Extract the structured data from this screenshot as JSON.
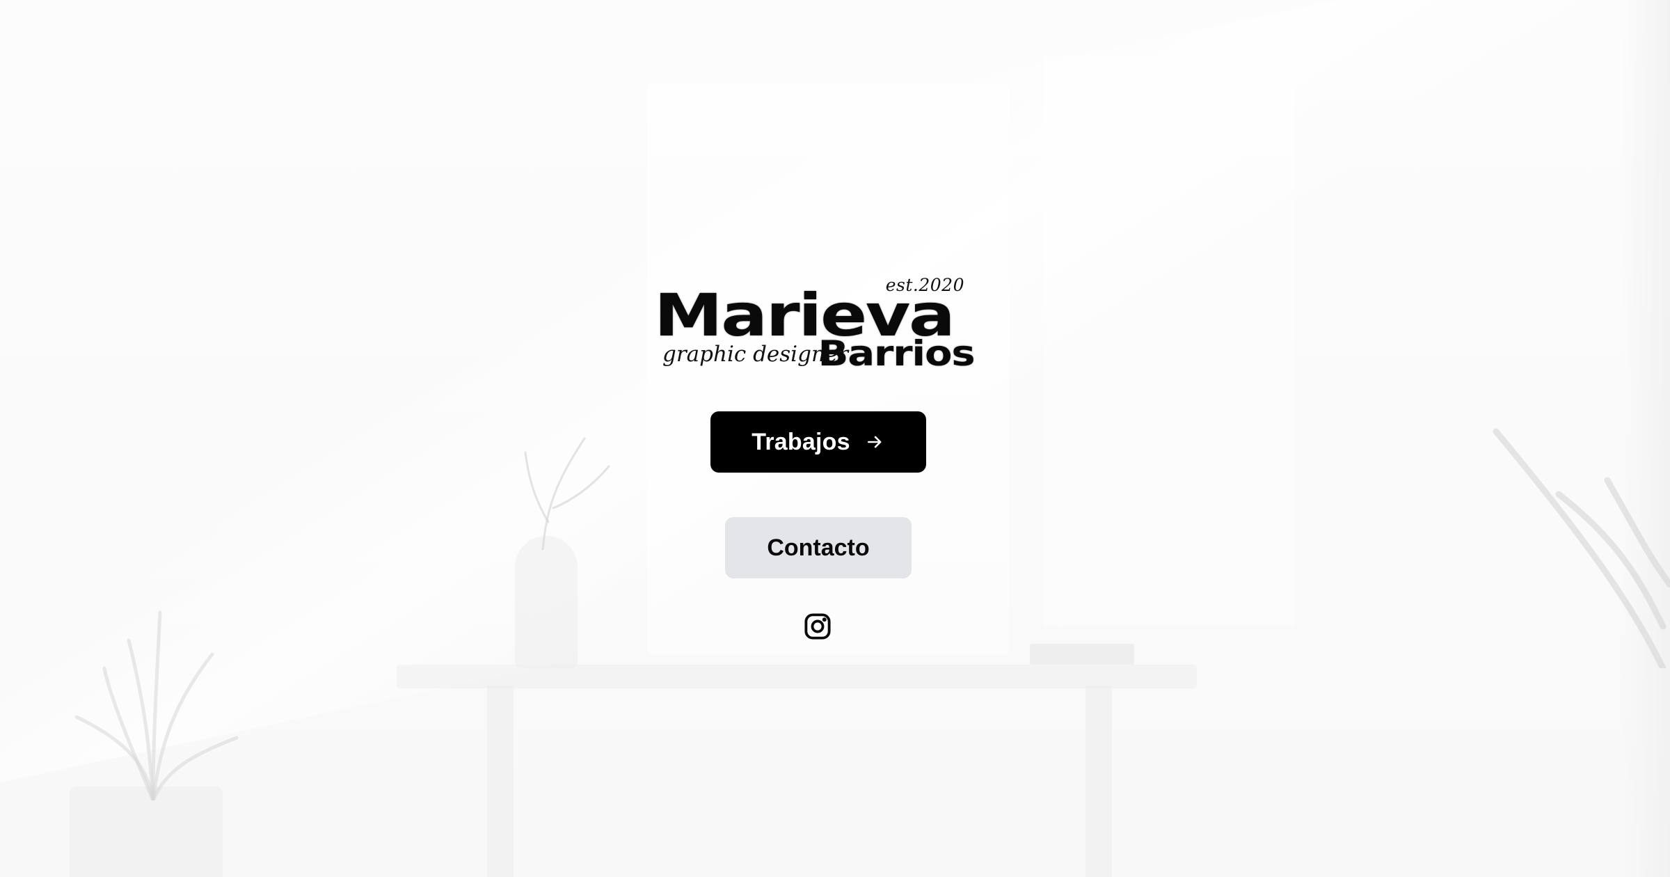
{
  "logo": {
    "established": "est.2020",
    "first_name": "Marieva",
    "tagline": "graphic designer",
    "last_name": "Barrios"
  },
  "actions": {
    "primary_label": "Trabajos",
    "primary_icon": "arrow-right-icon",
    "secondary_label": "Contacto"
  },
  "social": {
    "icon": "instagram-icon"
  },
  "colors": {
    "primary_button_bg": "#000000",
    "primary_button_text": "#ffffff",
    "secondary_button_bg": "#e4e5e9",
    "text": "#0a0a0a",
    "background": "#fbfbfb"
  }
}
